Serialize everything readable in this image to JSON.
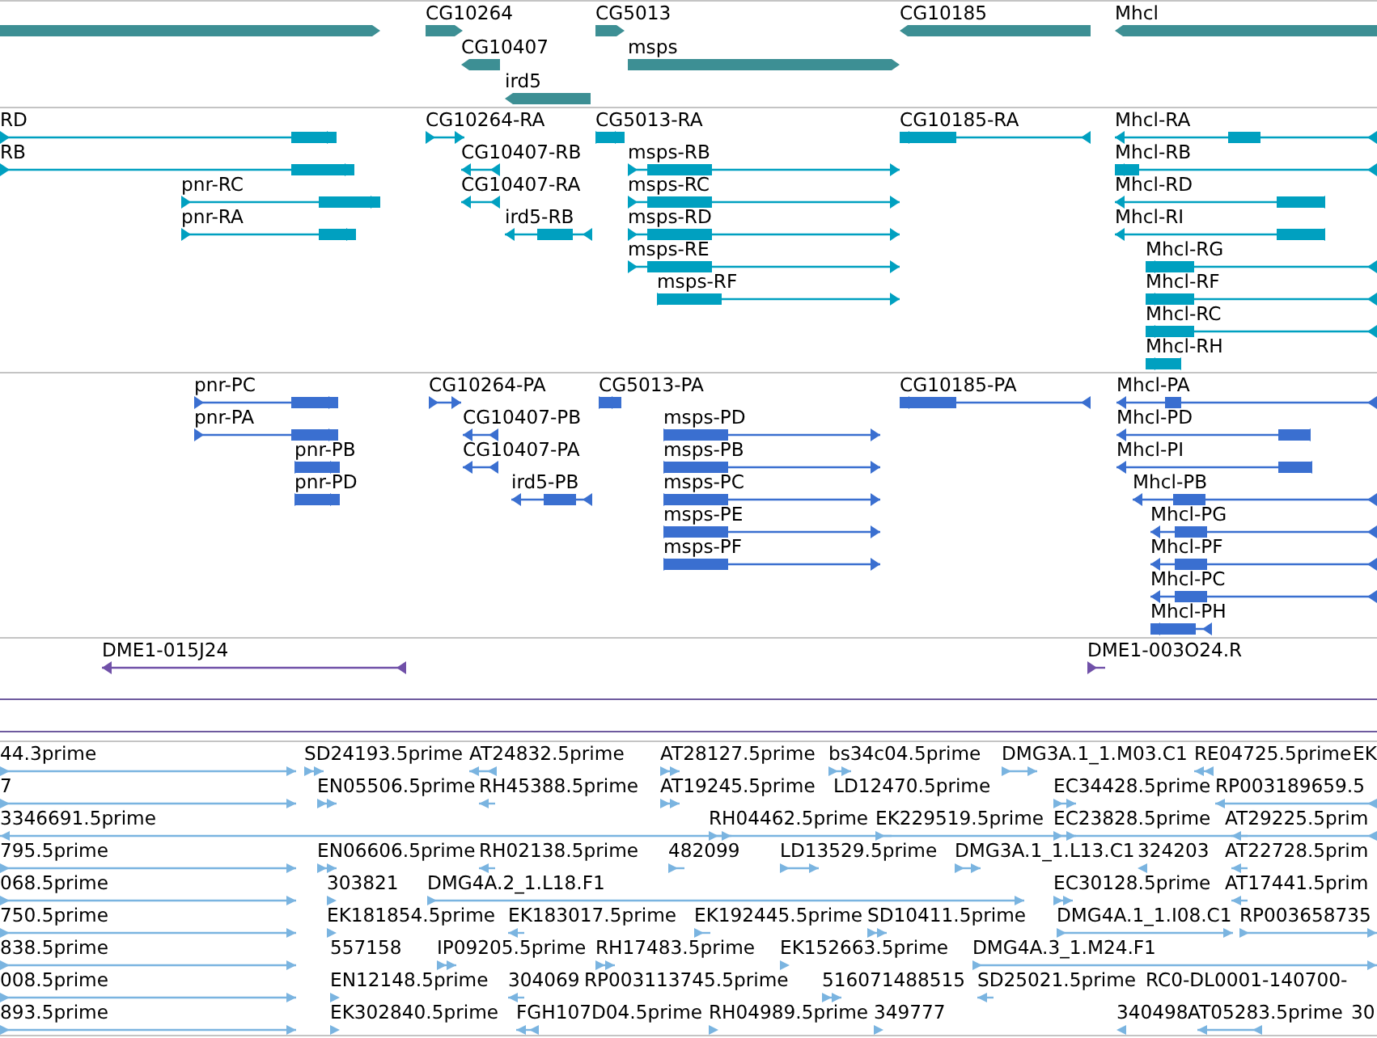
{
  "tracks": [
    {
      "kind": "gene",
      "color": "#3d8f94",
      "rows": [
        {
          "features": [
            {
              "reverse": false
            },
            {
              "label": "CG10264",
              "reverse": false
            },
            {
              "label": "CG5013",
              "reverse": false
            },
            {
              "label": "CG10185",
              "reverse": true
            },
            {
              "label": "Mhcl",
              "reverse": true
            }
          ]
        },
        {
          "features": [
            {
              "label": "CG10407",
              "reverse": true
            },
            {
              "label": "msps",
              "reverse": false
            }
          ]
        },
        {
          "features": [
            {
              "label": "ird5",
              "reverse": true
            }
          ]
        }
      ]
    },
    {
      "kind": "transcript",
      "color": "#00a0c0",
      "rows": [
        {
          "features": [
            {
              "label": "RD",
              "reverse": false
            },
            {
              "label": "CG10264-RA",
              "reverse": false
            },
            {
              "label": "CG5013-RA",
              "reverse": false
            },
            {
              "label": "CG10185-RA",
              "reverse": true
            },
            {
              "label": "Mhcl-RA",
              "reverse": true
            }
          ]
        },
        {
          "features": [
            {
              "label": "RB",
              "reverse": false
            },
            {
              "label": "CG10407-RB",
              "reverse": true
            },
            {
              "label": "msps-RB",
              "reverse": false
            },
            {
              "label": "Mhcl-RB",
              "reverse": true
            }
          ]
        },
        {
          "features": [
            {
              "label": "pnr-RC",
              "reverse": false
            },
            {
              "label": "CG10407-RA",
              "reverse": true
            },
            {
              "label": "msps-RC",
              "reverse": false
            },
            {
              "label": "Mhcl-RD",
              "reverse": true
            }
          ]
        },
        {
          "features": [
            {
              "label": "pnr-RA",
              "reverse": false
            },
            {
              "label": "ird5-RB",
              "reverse": true
            },
            {
              "label": "msps-RD",
              "reverse": false
            },
            {
              "label": "Mhcl-RI",
              "reverse": true
            }
          ]
        },
        {
          "features": [
            {
              "label": "msps-RE",
              "reverse": false
            },
            {
              "label": "Mhcl-RG",
              "reverse": true
            }
          ]
        },
        {
          "features": [
            {
              "label": "msps-RF",
              "reverse": false
            },
            {
              "label": "Mhcl-RF",
              "reverse": true
            }
          ]
        },
        {
          "features": [
            {
              "label": "Mhcl-RC",
              "reverse": true
            }
          ]
        },
        {
          "features": [
            {
              "label": "Mhcl-RH",
              "reverse": true
            }
          ]
        }
      ]
    },
    {
      "kind": "protein",
      "color": "#3a6fd0",
      "rows": [
        {
          "features": [
            {
              "label": "pnr-PC",
              "reverse": false
            },
            {
              "label": "CG10264-PA",
              "reverse": false
            },
            {
              "label": "CG5013-PA",
              "reverse": false
            },
            {
              "label": "CG10185-PA",
              "reverse": true
            },
            {
              "label": "Mhcl-PA",
              "reverse": true
            }
          ]
        },
        {
          "features": [
            {
              "label": "pnr-PA",
              "reverse": false
            },
            {
              "label": "CG10407-PB",
              "reverse": true
            },
            {
              "label": "msps-PD",
              "reverse": false
            },
            {
              "label": "Mhcl-PD",
              "reverse": true
            }
          ]
        },
        {
          "features": [
            {
              "label": "pnr-PB",
              "reverse": false
            },
            {
              "label": "CG10407-PA",
              "reverse": true
            },
            {
              "label": "msps-PB",
              "reverse": false
            },
            {
              "label": "Mhcl-PI",
              "reverse": true
            }
          ]
        },
        {
          "features": [
            {
              "label": "pnr-PD",
              "reverse": false
            },
            {
              "label": "ird5-PB",
              "reverse": true
            },
            {
              "label": "msps-PC",
              "reverse": false
            },
            {
              "label": "Mhcl-PB",
              "reverse": true
            }
          ]
        },
        {
          "features": [
            {
              "label": "msps-PE",
              "reverse": false
            },
            {
              "label": "Mhcl-PG",
              "reverse": true
            }
          ]
        },
        {
          "features": [
            {
              "label": "msps-PF",
              "reverse": false
            },
            {
              "label": "Mhcl-PF",
              "reverse": true
            }
          ]
        },
        {
          "features": [
            {
              "label": "Mhcl-PC",
              "reverse": true
            }
          ]
        },
        {
          "features": [
            {
              "label": "Mhcl-PH",
              "reverse": true
            }
          ]
        }
      ]
    },
    {
      "kind": "clone",
      "color": "#7050a8",
      "rows": [
        {
          "features": [
            {
              "label": "DME1-015J24",
              "reverse": true
            },
            {
              "label": "DME1-003O24.R",
              "reverse": false
            }
          ]
        }
      ]
    },
    {
      "kind": "est",
      "color": "#7ab4e0",
      "rows": [
        {
          "features": [
            {
              "label": "44.3prime",
              "reverse": false
            },
            {
              "label": "SD24193.5prime",
              "reverse": false
            },
            {
              "label": "AT24832.5prime",
              "reverse": true
            },
            {
              "label": "AT28127.5prime",
              "reverse": false
            },
            {
              "label": "bs34c04.5prime",
              "reverse": false
            },
            {
              "label": "DMG3A.1_1.M03.C1",
              "reverse": false
            },
            {
              "label": "RE04725.5prime",
              "reverse": true
            },
            {
              "label": "EK"
            }
          ]
        },
        {
          "features": [
            {
              "label": "7",
              "reverse": false
            },
            {
              "label": "EN05506.5prime",
              "reverse": false
            },
            {
              "label": "RH45388.5prime",
              "reverse": true
            },
            {
              "label": "AT19245.5prime",
              "reverse": false
            },
            {
              "label": "LD12470.5prime"
            },
            {
              "label": "EC34428.5prime",
              "reverse": false
            },
            {
              "label": "RP003189659.5",
              "reverse": true
            }
          ]
        },
        {
          "features": [
            {
              "label": "3346691.5prime",
              "reverse": true
            },
            {
              "label": "RH04462.5prime",
              "reverse": false
            },
            {
              "label": "EK229519.5prime",
              "reverse": false
            },
            {
              "label": "EC23828.5prime",
              "reverse": false
            },
            {
              "label": "AT29225.5prim",
              "reverse": true
            }
          ]
        },
        {
          "features": [
            {
              "label": "795.5prime",
              "reverse": false
            },
            {
              "label": "EN06606.5prime",
              "reverse": false
            },
            {
              "label": "RH02138.5prime",
              "reverse": true
            },
            {
              "label": "482099",
              "reverse": false
            },
            {
              "label": "LD13529.5prime",
              "reverse": false
            },
            {
              "label": "DMG3A.1_1.L13.C1",
              "reverse": false
            },
            {
              "label": "324203",
              "reverse": true
            },
            {
              "label": "AT22728.5prim",
              "reverse": true
            }
          ]
        },
        {
          "features": [
            {
              "label": "068.5prime",
              "reverse": false
            },
            {
              "label": "303821",
              "reverse": false
            },
            {
              "label": "DMG4A.2_1.L18.F1",
              "reverse": false
            },
            {
              "label": "EC30128.5prime",
              "reverse": false
            },
            {
              "label": "AT17441.5prim",
              "reverse": true
            }
          ]
        },
        {
          "features": [
            {
              "label": "750.5prime",
              "reverse": false
            },
            {
              "label": "EK181854.5prime",
              "reverse": false
            },
            {
              "label": "EK183017.5prime",
              "reverse": true
            },
            {
              "label": "EK192445.5prime",
              "reverse": false
            },
            {
              "label": "SD10411.5prime",
              "reverse": false
            },
            {
              "label": "DMG4A.1_1.I08.C1",
              "reverse": false
            },
            {
              "label": "RP003658735",
              "reverse": false
            }
          ]
        },
        {
          "features": [
            {
              "label": "838.5prime",
              "reverse": false
            },
            {
              "label": "557158"
            },
            {
              "label": "IP09205.5prime",
              "reverse": false
            },
            {
              "label": "RH17483.5prime",
              "reverse": false
            },
            {
              "label": "EK152663.5prime",
              "reverse": false
            },
            {
              "label": "DMG4A.3_1.M24.F1",
              "reverse": false
            }
          ]
        },
        {
          "features": [
            {
              "label": "008.5prime",
              "reverse": false
            },
            {
              "label": "EN12148.5prime",
              "reverse": false
            },
            {
              "label": "304069",
              "reverse": true
            },
            {
              "label": "RP003113745.5prime"
            },
            {
              "label": "516071488515",
              "reverse": false
            },
            {
              "label": "SD25021.5prime",
              "reverse": true
            },
            {
              "label": "RC0-DL0001-140700-"
            }
          ]
        },
        {
          "features": [
            {
              "label": "893.5prime",
              "reverse": false
            },
            {
              "label": "EK302840.5prime",
              "reverse": false
            },
            {
              "label": "FGH107D04.5prime",
              "reverse": true
            },
            {
              "label": "RH04989.5prime",
              "reverse": false
            },
            {
              "label": "349777",
              "reverse": false
            },
            {
              "label": "340498",
              "reverse": true
            },
            {
              "label": "AT05283.5prime",
              "reverse": true
            },
            {
              "label": "30"
            }
          ]
        }
      ]
    }
  ]
}
